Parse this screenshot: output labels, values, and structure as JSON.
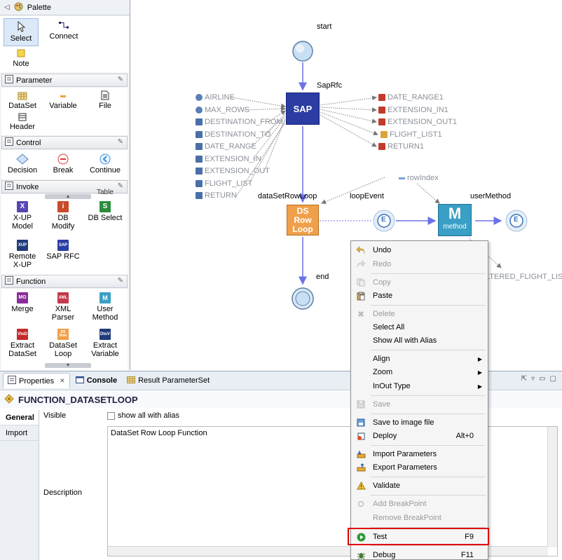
{
  "palette": {
    "title": "Palette",
    "tools": [
      {
        "label": "Select"
      },
      {
        "label": "Connect"
      },
      {
        "label": "Note"
      }
    ],
    "sections": [
      {
        "title": "Parameter",
        "items": [
          {
            "label": "DataSet"
          },
          {
            "label": "Variable"
          },
          {
            "label": "File"
          },
          {
            "label": "Header"
          }
        ]
      },
      {
        "title": "Control",
        "items": [
          {
            "label": "Decision"
          },
          {
            "label": "Break"
          },
          {
            "label": "Continue"
          }
        ]
      },
      {
        "title": "Invoke",
        "peek": "Table",
        "items": [
          {
            "label": "X-UP Model"
          },
          {
            "label": "DB Modify"
          },
          {
            "label": "DB Select"
          },
          {
            "label": "Remote X-UP"
          },
          {
            "label": "SAP RFC"
          }
        ]
      },
      {
        "title": "Function",
        "items": [
          {
            "label": "Merge"
          },
          {
            "label": "XML Parser"
          },
          {
            "label": "User Method"
          },
          {
            "label": "Extract DataSet"
          },
          {
            "label": "DataSet Loop"
          },
          {
            "label": "Extract Variable"
          }
        ]
      }
    ]
  },
  "canvas": {
    "nodes": {
      "start": "start",
      "saprfc": "SapRfc",
      "sap_icon": "SAP",
      "loop_label": "dataSetRowLoop",
      "loop_icon": [
        "DS",
        "Row",
        "Loop"
      ],
      "loop_event": "loopEvent",
      "event_icon": "E",
      "user_method": "userMethod",
      "method_icon_letter": "M",
      "method_icon_text": "method",
      "end": "end",
      "row_index": "rowIndex",
      "filtered_list": "LTERED_FLIGHT_LIST"
    },
    "inputs": [
      "AIRLINE",
      "MAX_ROWS",
      "DESTINATION_FROM",
      "DESTINATION_TO",
      "DATE_RANGE",
      "EXTENSION_IN",
      "EXTENSION_OUT",
      "FLIGHT_LIST",
      "RETURN"
    ],
    "outputs": [
      "DATE_RANGE1",
      "EXTENSION_IN1",
      "EXTENSION_OUT1",
      "FLIGHT_LIST1",
      "RETURN1"
    ]
  },
  "bottom": {
    "tabs": [
      {
        "label": "Properties",
        "close": "✕"
      },
      {
        "label": "Console"
      },
      {
        "label": "Result ParameterSet"
      }
    ],
    "title": "FUNCTION_DATASETLOOP",
    "vtabs": [
      "General",
      "Import"
    ],
    "visible_label": "Visible",
    "show_alias_label": "show all with alias",
    "description_label": "Description",
    "description_value": "DataSet Row Loop Function"
  },
  "context_menu": {
    "items": [
      {
        "label": "Undo",
        "icon": "undo-icon",
        "enabled": true
      },
      {
        "label": "Redo",
        "icon": "redo-icon",
        "enabled": false
      },
      {
        "label": "Copy",
        "icon": "copy-icon",
        "enabled": false
      },
      {
        "label": "Paste",
        "icon": "paste-icon",
        "enabled": true
      },
      {
        "label": "Delete",
        "icon": "delete-icon",
        "enabled": false
      },
      {
        "label": "Select All",
        "enabled": true
      },
      {
        "label": "Show All with Alias",
        "enabled": true
      },
      {
        "label": "Align",
        "enabled": true,
        "submenu": true
      },
      {
        "label": "Zoom",
        "enabled": true,
        "submenu": true
      },
      {
        "label": "InOut Type",
        "enabled": true,
        "submenu": true
      },
      {
        "label": "Save",
        "icon": "save-icon",
        "enabled": false
      },
      {
        "label": "Save to image file",
        "icon": "image-icon",
        "enabled": true
      },
      {
        "label": "Deploy",
        "icon": "deploy-icon",
        "enabled": true,
        "shortcut": "Alt+0"
      },
      {
        "label": "Import Parameters",
        "icon": "import-icon",
        "enabled": true
      },
      {
        "label": "Export Parameters",
        "icon": "export-icon",
        "enabled": true
      },
      {
        "label": "Validate",
        "icon": "warning-icon",
        "enabled": true
      },
      {
        "label": "Add BreakPoint",
        "icon": "breakpoint-icon",
        "enabled": false
      },
      {
        "label": "Remove BreakPoint",
        "enabled": false
      },
      {
        "label": "Test",
        "icon": "run-icon",
        "enabled": true,
        "shortcut": "F9"
      },
      {
        "label": "Debug",
        "icon": "debug-icon",
        "enabled": true,
        "shortcut": "F11"
      }
    ]
  },
  "colors": {
    "sap_blue": "#2b3da3",
    "loop_orange": "#f0a04a",
    "method_teal": "#3a9fc4",
    "flow_arrow": "#6b73e6",
    "highlight_red": "#e00000"
  }
}
